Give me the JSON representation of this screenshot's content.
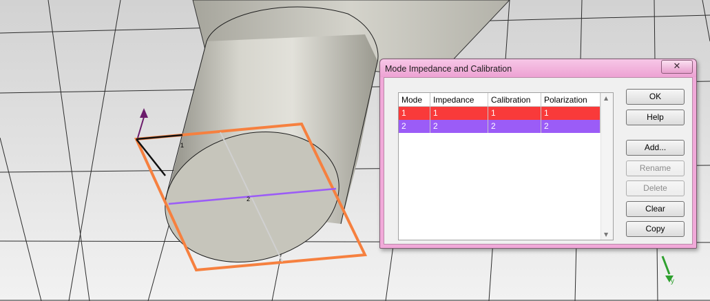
{
  "dialog": {
    "title": "Mode Impedance and Calibration",
    "close_glyph": "✕",
    "columns": [
      "Mode",
      "Impedance",
      "Calibration",
      "Polarization"
    ],
    "rows": [
      {
        "mode": "1",
        "impedance": "1",
        "calibration": "1",
        "polarization": "1",
        "color": "#f93a3a"
      },
      {
        "mode": "2",
        "impedance": "2",
        "calibration": "2",
        "polarization": "2",
        "color": "#9b5cf7"
      }
    ],
    "buttons": {
      "ok": "OK",
      "help": "Help",
      "add": "Add...",
      "rename": "Rename",
      "delete": "Delete",
      "clear": "Clear",
      "copy": "Copy"
    }
  },
  "scene": {
    "port_label_1": "1",
    "port_label_2": "2",
    "axis_label_y": "y",
    "colors": {
      "port_outline": "#f6803f",
      "mode_1_line": "#101010",
      "mode_2_line": "#9b5cf7",
      "cylinder": "#c9c8be",
      "grid_line": "#1e1e1e",
      "axis_arrow": "#6b1b6b",
      "axis_y": "#2ea02e"
    }
  }
}
